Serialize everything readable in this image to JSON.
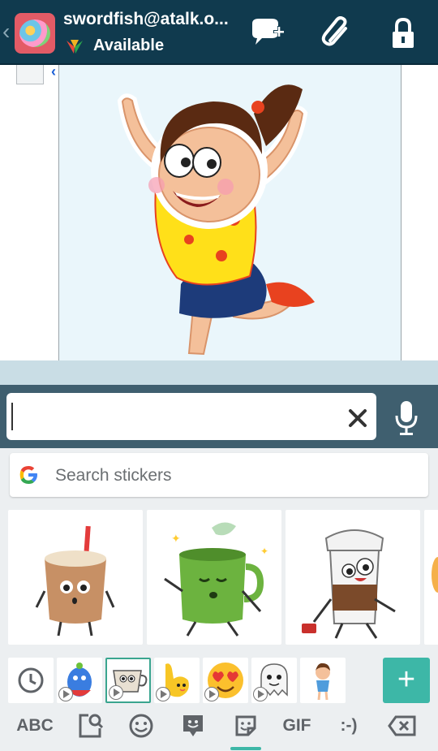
{
  "header": {
    "contact_name": "swordfish@atalk.o...",
    "status": "Available",
    "icons": [
      "back-chevron-icon",
      "new-chat-icon",
      "paperclip-icon",
      "lock-icon"
    ],
    "back_glyph": "‹"
  },
  "chat": {
    "collapse_glyph": "‹"
  },
  "input": {
    "value": "",
    "clear_icon": "close-icon",
    "mic_icon": "microphone-icon"
  },
  "keyboard": {
    "search": {
      "placeholder": "Search stickers"
    },
    "stickers": [
      "iced-coffee-sticker",
      "green-tea-mug-sticker",
      "coffee-to-go-sticker"
    ],
    "packs": [
      "recent",
      "blue-bird",
      "coffee-cup",
      "yellow-hand",
      "heart-eyes",
      "ghost",
      "girl"
    ],
    "selected_pack": "coffee-cup",
    "add_label": "+",
    "nav": {
      "abc": "ABC",
      "gif": "GIF",
      "emoticon": ":-)",
      "active": "stickers"
    }
  },
  "colors": {
    "header_bg": "#103a4e",
    "input_bar_bg": "#3f5f6f",
    "accent": "#3db7a7"
  }
}
